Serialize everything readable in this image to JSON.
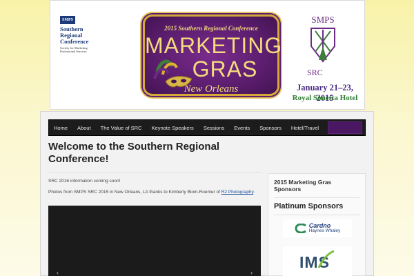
{
  "banner": {
    "smps_box": "SMPS",
    "smps_name": "Southern\nRegional\nConference",
    "smps_sub": "Society for Marketing Professional Services",
    "conference_line": "2015 Southern Regional Conference",
    "title_line1": "MARKETING",
    "title_line2": "GRAS",
    "city": "New Orleans",
    "event_logo_top": "SMPS",
    "event_logo_bottom": "SRC",
    "dates": "January 21–23, 2015",
    "hotel": "Royal Sonesta Hotel"
  },
  "nav": {
    "items": [
      "Home",
      "About",
      "The Value of SRC",
      "Keynote Speakers",
      "Sessions",
      "Events",
      "Sponsors",
      "Hotel/Travel"
    ]
  },
  "main": {
    "title": "Welcome to the Southern Regional Conference!",
    "para1": "SRC 2016 information coming soon!",
    "para2_prefix": "Photos from SMPS SRC 2015 in New Orleans, LA thanks to Kimberly Blom-Roemer of ",
    "para2_link": "R2 Photography",
    "para2_suffix": ".",
    "video_prev": "‹",
    "video_next": "›"
  },
  "sidebar": {
    "title": "2015 Marketing Gras Sponsors",
    "platinum_heading": "Platinum Sponsors",
    "sponsor1_name": "Cardno",
    "sponsor1_sub": "Haynes Whaley",
    "sponsor2_name": "IMS"
  },
  "colors": {
    "nav_bg": "#1c1c1c",
    "accent_purple": "#5b1d6e",
    "gold": "#f4db7d",
    "link": "#1a4d9e"
  }
}
